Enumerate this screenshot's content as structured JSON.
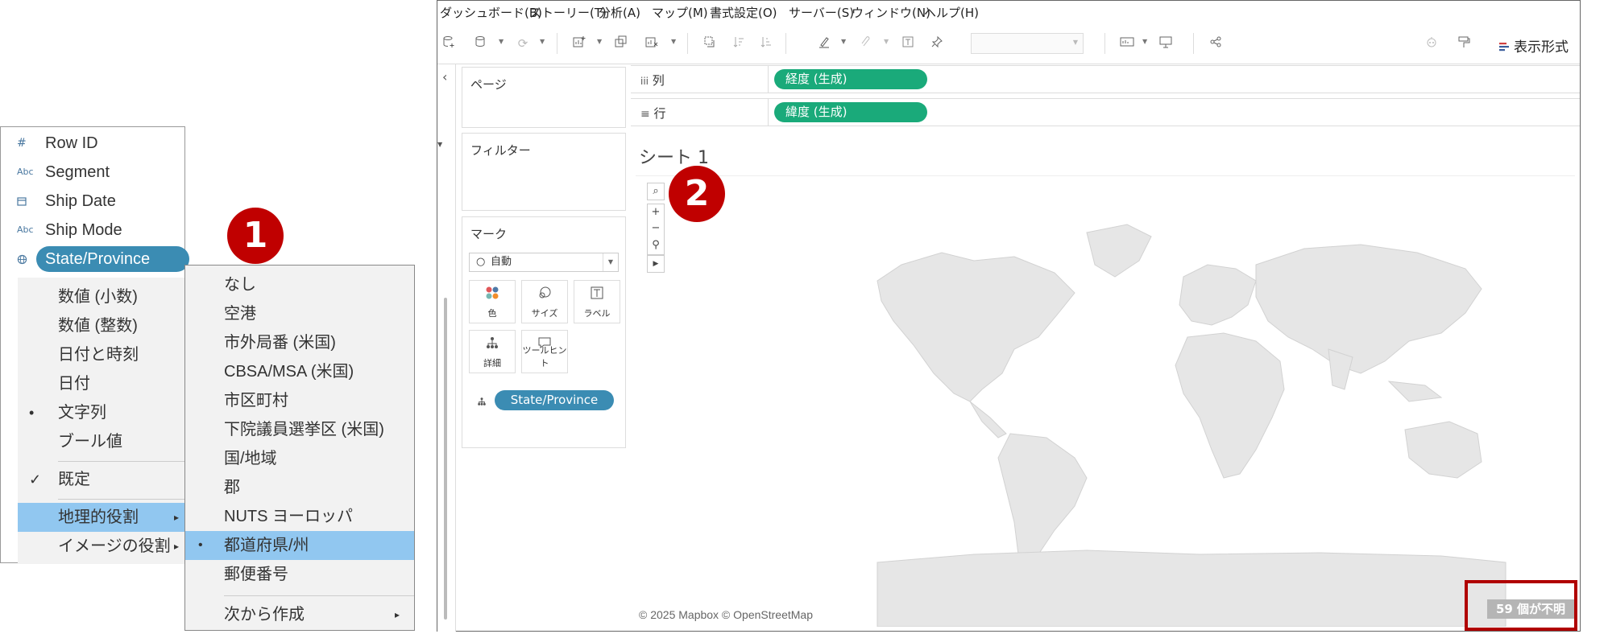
{
  "field_panel": {
    "fields": [
      {
        "type_icon": "#",
        "label": "Row ID"
      },
      {
        "type_icon": "Abc",
        "label": "Segment"
      },
      {
        "type_icon": "calendar-icon",
        "label": "Ship Date"
      },
      {
        "type_icon": "Abc",
        "label": "Ship Mode"
      },
      {
        "type_icon": "globe-icon",
        "label": "State/Province"
      }
    ]
  },
  "context_menu": {
    "items": [
      "数値 (小数)",
      "数値 (整数)",
      "日付と時刻",
      "日付",
      "文字列",
      "ブール値",
      "既定",
      "地理的役割",
      "イメージの役割"
    ],
    "bullet": "•",
    "check": "✓",
    "arrow": "▸"
  },
  "geo_submenu": {
    "items": [
      "なし",
      "空港",
      "市外局番 (米国)",
      "CBSA/MSA (米国)",
      "市区町村",
      "下院議員選挙区 (米国)",
      "国/地域",
      "郡",
      "NUTS ヨーロッパ",
      "都道府県/州",
      "郵便番号",
      "次から作成"
    ],
    "bullet": "•",
    "arrow": "▸"
  },
  "callouts": {
    "one": "1",
    "two": "2"
  },
  "app": {
    "menu_bar": [
      "ダッシュボード(B)",
      "ストーリー(T)",
      "分析(A)",
      "マップ(M)",
      "書式設定(O)",
      "サーバー(S)",
      "ウィンドウ(N)",
      "ヘルプ(H)"
    ],
    "format_label": "表示形式",
    "collapse_arrow": "‹",
    "pages_label": "ページ",
    "filters_label": "フィルター",
    "marks": {
      "title": "マーク",
      "type": "自動",
      "buttons": [
        "色",
        "サイズ",
        "ラベル",
        "詳細",
        "ツールヒント"
      ],
      "detail_pill": "State/Province"
    },
    "columns": {
      "label": "列",
      "pill": "経度 (生成)"
    },
    "rows": {
      "label": "行",
      "pill": "緯度 (生成)"
    },
    "sheet_title": "シート 1",
    "copyright": "© 2025 Mapbox © OpenStreetMap",
    "unknown_badge": "59 個が不明"
  },
  "colors": {
    "pill_blue": "#3b8cb3",
    "pill_green": "#1aaa7a",
    "highlight": "#91c7f0",
    "callout_red": "#c00000"
  }
}
